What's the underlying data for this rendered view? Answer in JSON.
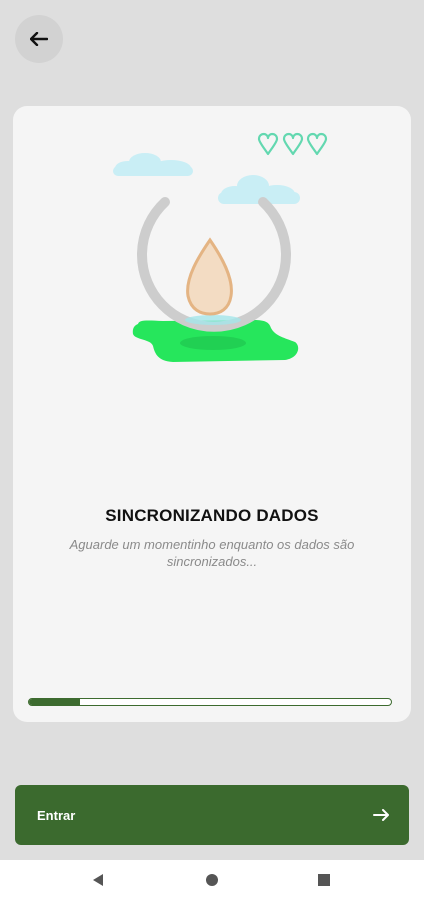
{
  "colors": {
    "background": "#dedede",
    "card": "#f5f5f5",
    "accent_green": "#3b6a2e",
    "grass_green": "#26e65c",
    "heart_outline": "#63d8b0",
    "cloud": "#c9eef5",
    "seed": "#f3dcc3"
  },
  "header": {
    "back_icon": "arrow-left-icon"
  },
  "sync": {
    "title": "SINCRONIZANDO DADOS",
    "subtitle": "Aguarde um momentinho enquanto os dados são sincronizados...",
    "progress_fraction": 0.14,
    "lives_count": 3
  },
  "footer": {
    "enter_label": "Entrar",
    "enter_icon": "arrow-right-icon"
  },
  "system_nav": {
    "back_icon": "triangle-back-icon",
    "home_icon": "circle-home-icon",
    "recents_icon": "square-recents-icon"
  }
}
